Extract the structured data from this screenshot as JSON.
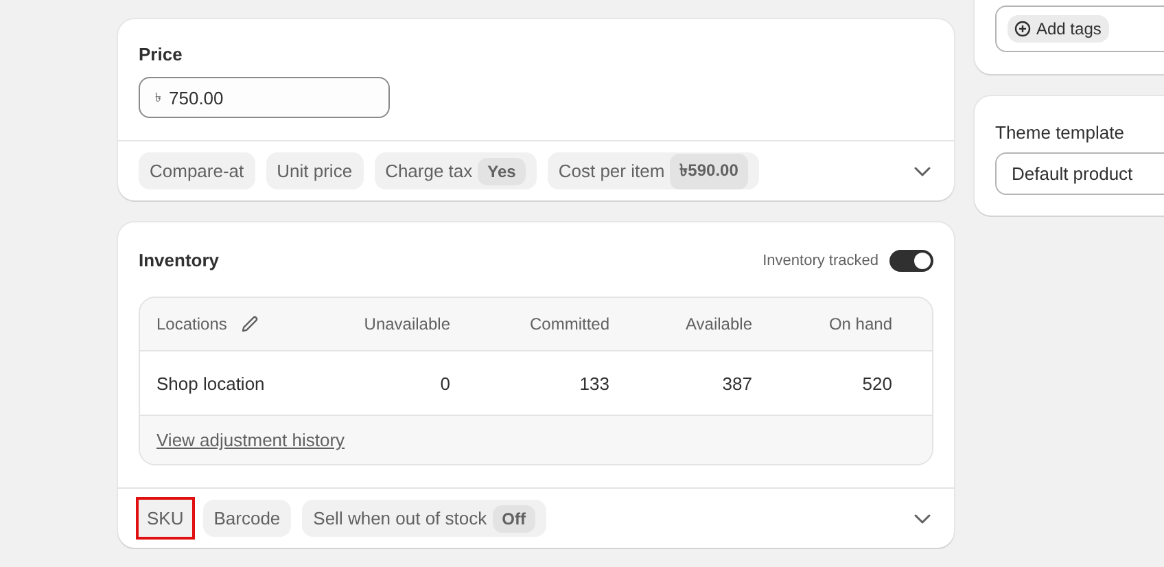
{
  "price": {
    "title": "Price",
    "currency": "৳",
    "value": "750.00",
    "options": [
      {
        "label": "Compare-at",
        "highlighted": false
      },
      {
        "label": "Unit price",
        "highlighted": false
      },
      {
        "label": "Charge tax",
        "value": "Yes",
        "highlighted": false
      },
      {
        "label": "Cost per item",
        "value": "৳590.00",
        "highlighted": false
      }
    ]
  },
  "inventory": {
    "title": "Inventory",
    "tracked_label": "Inventory tracked",
    "tracked": true,
    "columns": [
      "Locations",
      "Unavailable",
      "Committed",
      "Available",
      "On hand"
    ],
    "rows": [
      {
        "cells": [
          "Shop location",
          "0",
          "133",
          "387",
          "520"
        ]
      }
    ],
    "footer_link": "View adjustment history",
    "options": [
      {
        "label": "SKU",
        "highlighted": true
      },
      {
        "label": "Barcode",
        "highlighted": false
      },
      {
        "label": "Sell when out of stock",
        "value": "Off",
        "highlighted": false
      }
    ]
  },
  "sidebar": {
    "tags_button": "Add tags",
    "theme_template": {
      "label": "Theme template",
      "value": "Default product"
    }
  }
}
